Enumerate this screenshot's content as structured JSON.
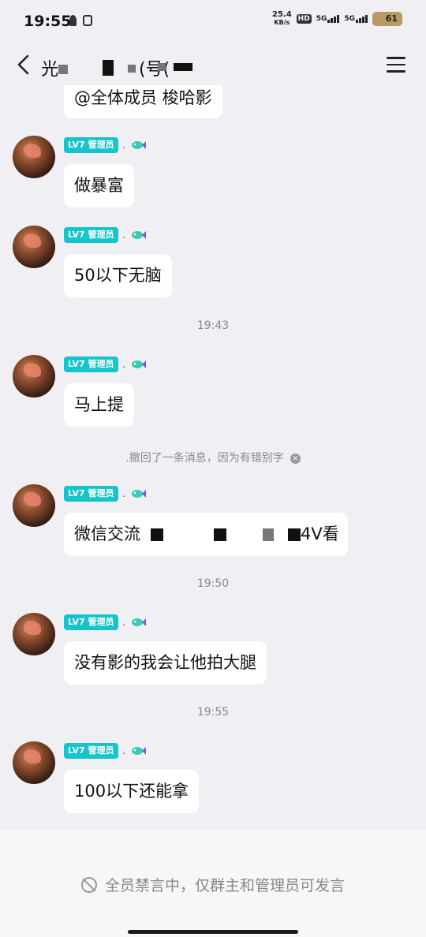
{
  "status_bar": {
    "time": "19:55",
    "net_speed_value": "25.4",
    "net_speed_unit": "KB/s",
    "hd_label": "HD",
    "sim1_label": "5G",
    "sim2_label": "5G",
    "battery_level": "61"
  },
  "header": {
    "title_visible_prefix": "光",
    "title_visible_fragment": "(号(",
    "back_icon": "chevron-left-icon",
    "menu_icon": "hamburger-menu-icon"
  },
  "messages": [
    {
      "type": "bubble_only",
      "text": "@全体成员  梭哈影"
    },
    {
      "type": "message",
      "role": "LV7 管理员",
      "sep": ".",
      "text": "做暴富"
    },
    {
      "type": "message",
      "role": "LV7 管理员",
      "sep": ".",
      "text": "50以下无脑"
    },
    {
      "type": "timestamp",
      "text": "19:43"
    },
    {
      "type": "message",
      "role": "LV7 管理员",
      "sep": ".",
      "text": "马上提"
    },
    {
      "type": "notice",
      "text": ".撤回了一条消息，因为有错别字"
    },
    {
      "type": "message",
      "role": "LV7 管理员",
      "sep": ".",
      "text_prefix": "微信交流",
      "text_suffix": "4V看"
    },
    {
      "type": "timestamp",
      "text": "19:50"
    },
    {
      "type": "message",
      "role": "LV7 管理员",
      "sep": ".",
      "text": "没有影的我会让他拍大腿"
    },
    {
      "type": "timestamp",
      "text": "19:55"
    },
    {
      "type": "message",
      "role": "LV7 管理员",
      "sep": ".",
      "text": "100以下还能拿"
    }
  ],
  "footer": {
    "mute_text": "全员禁言中，仅群主和管理员可发言",
    "mute_icon": "mute-icon"
  }
}
